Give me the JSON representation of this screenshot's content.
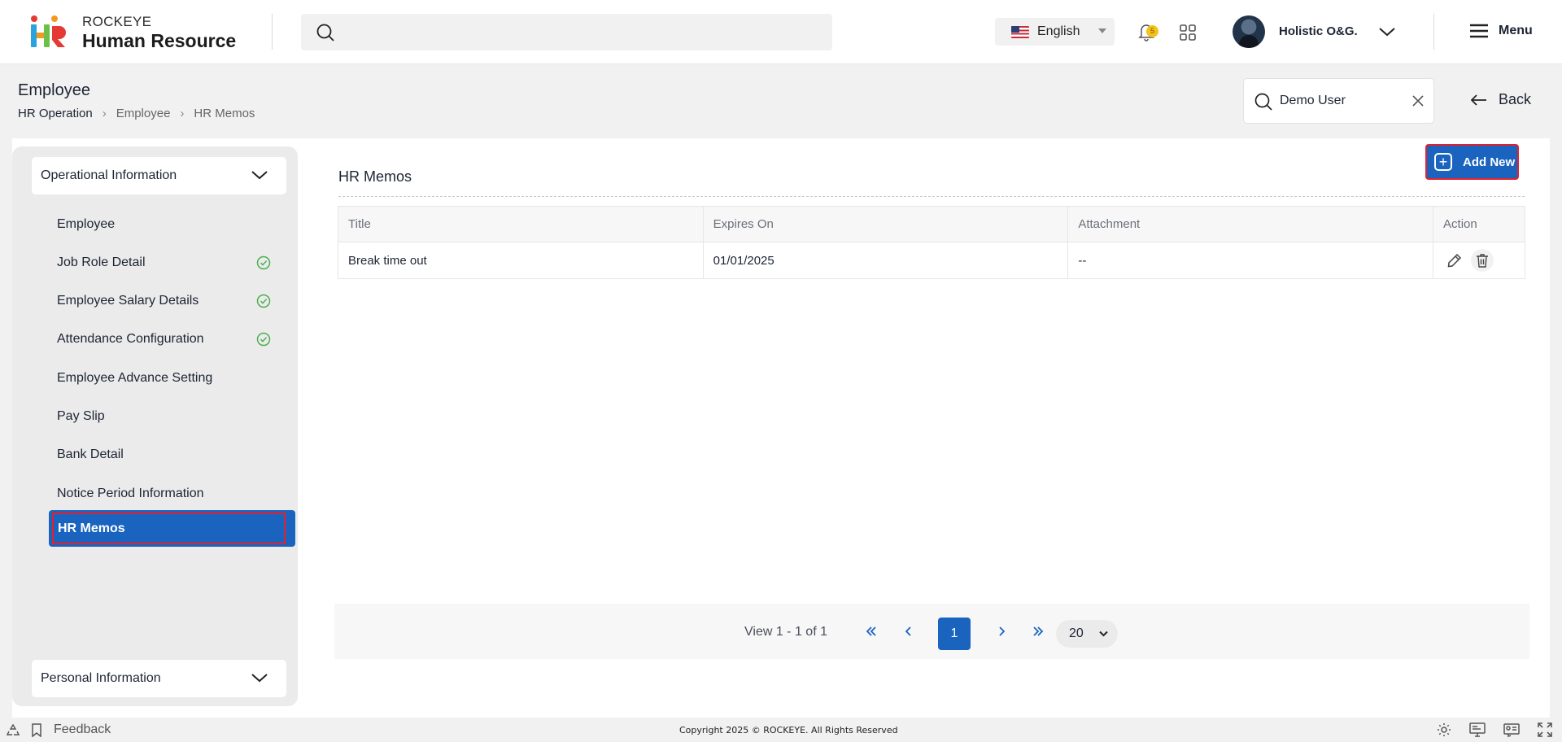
{
  "brand": {
    "small": "ROCKEYE",
    "big": "Human Resource"
  },
  "header": {
    "language": "English",
    "notification_count": "5",
    "user_name": "Holistic O&G.",
    "menu_label": "Menu"
  },
  "page": {
    "title": "Employee",
    "breadcrumb": [
      "HR Operation",
      "Employee",
      "HR Memos"
    ],
    "user_search_value": "Demo User",
    "back_label": "Back"
  },
  "sidebar": {
    "section_top": "Operational Information",
    "items": [
      {
        "label": "Employee",
        "done": false
      },
      {
        "label": "Job Role Detail",
        "done": true
      },
      {
        "label": "Employee Salary Details",
        "done": true
      },
      {
        "label": "Attendance Configuration",
        "done": true
      },
      {
        "label": "Employee Advance Setting",
        "done": false
      },
      {
        "label": "Pay Slip",
        "done": false
      },
      {
        "label": "Bank Detail",
        "done": false
      },
      {
        "label": "Notice Period Information",
        "done": false
      },
      {
        "label": "HR Memos",
        "done": false,
        "active": true
      }
    ],
    "section_bottom": "Personal Information"
  },
  "main": {
    "title": "HR Memos",
    "add_label": "Add New",
    "columns": [
      "Title",
      "Expires On",
      "Attachment",
      "Action"
    ],
    "rows": [
      {
        "title": "Break time out",
        "expires": "01/01/2025",
        "attachment": "--"
      }
    ]
  },
  "pagination": {
    "info": "View 1 - 1 of 1",
    "current_page": "1",
    "page_size": "20"
  },
  "footer": {
    "feedback": "Feedback",
    "copyright": "Copyright 2025 © ROCKEYE. All Rights Reserved"
  },
  "colors": {
    "primary": "#1a64c0",
    "highlight": "#e5202a",
    "check": "#4caf50",
    "badge": "#f4c21a"
  }
}
